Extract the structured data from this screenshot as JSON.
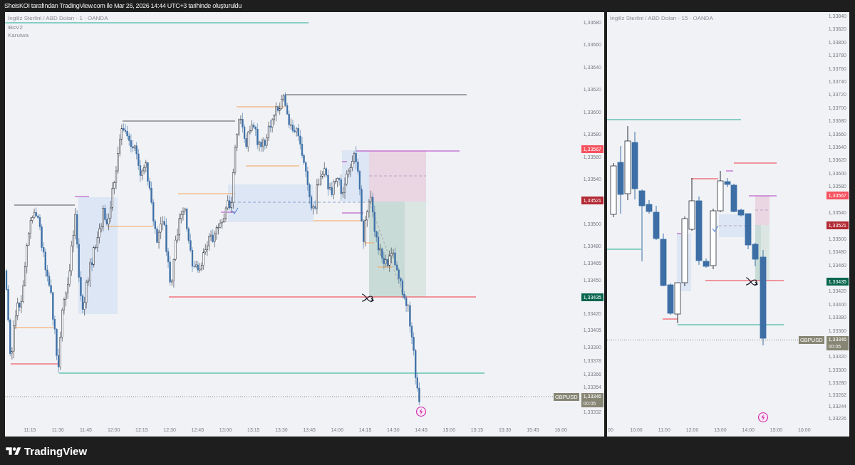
{
  "header": {
    "caption": "SheisKOI tarafından TradingView.com ile Mar 26, 2026 14:44 UTC+3 tarihinde oluşturuldu"
  },
  "panes": [
    {
      "title": "İngiliz Sterlini / ABD Doları · 1 · OANDA",
      "indicators": [
        "iBsV2",
        "Karuiwa"
      ],
      "price_ticks": [
        "1,33680",
        "1,33660",
        "1,33640",
        "1,33620",
        "1,33600",
        "1,33580",
        "1,33560",
        "1,33540",
        "1,33500",
        "1,33480",
        "1,33465",
        "1,33450",
        "1,33420",
        "1,33405",
        "1,33390",
        "1,33378",
        "1,33366",
        "1,33354",
        "1,33332"
      ],
      "price_tags": [
        {
          "text": "1,33567",
          "color": "#f7525f"
        },
        {
          "text": "1,33521",
          "color": "#b22833"
        },
        {
          "text": "1,33435",
          "color": "#08664f"
        }
      ],
      "last_price": {
        "symbol": "GBPUSD",
        "price": "1,33346",
        "countdown": "00:05",
        "color": "#878674"
      },
      "time_ticks": [
        "11:15",
        "11:30",
        "11:45",
        "12:00",
        "12:15",
        "12:30",
        "12:45",
        "13:00",
        "13:15",
        "13:30",
        "13:45",
        "14:00",
        "14:15",
        "14:30",
        "14:45",
        "15:00",
        "15:15",
        "15:30",
        "15:45",
        "16:00"
      ]
    },
    {
      "title": "İngiliz Sterlini / ABD Doları · 15 · OANDA",
      "price_ticks": [
        "1,33840",
        "1,33820",
        "1,33800",
        "1,33780",
        "1,33760",
        "1,33740",
        "1,33720",
        "1,33700",
        "1,33680",
        "1,33660",
        "1,33640",
        "1,33620",
        "1,33600",
        "1,33580",
        "1,33540",
        "1,33500",
        "1,33480",
        "1,33460",
        "1,33420",
        "1,33400",
        "1,33380",
        "1,33360",
        "1,33320",
        "1,33300",
        "1,33280",
        "1,33262",
        "1,33244",
        "1,33226"
      ],
      "price_tags": [
        {
          "text": "1,33567",
          "color": "#f7525f"
        },
        {
          "text": "1,33521",
          "color": "#b22833"
        },
        {
          "text": "1,33435",
          "color": "#08664f"
        }
      ],
      "last_price": {
        "symbol": "GBPUSD",
        "price": "1,33346",
        "countdown": "00:05",
        "color": "#878674"
      },
      "time_ticks": [
        "00",
        "10:00",
        "11:00",
        "12:00",
        "13:00",
        "14:00",
        "15:00",
        "16:00"
      ]
    }
  ],
  "footer": {
    "logo_text": "TradingView"
  }
}
